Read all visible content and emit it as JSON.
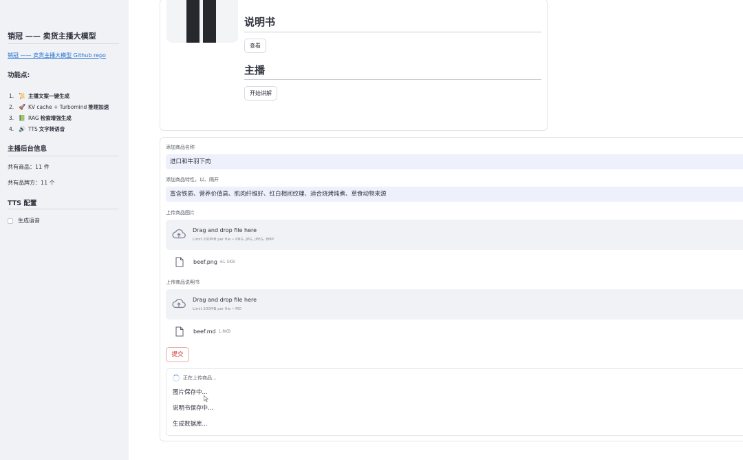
{
  "sidebar": {
    "title": "销冠 —— 卖货主播大模型",
    "repo_link": "销冠 —— 卖货主播大模型 Github repo",
    "features_heading": "功能点:",
    "features": [
      {
        "num": "1.",
        "icon": "scroll-icon",
        "glyph": "📜",
        "plain": "",
        "bold": "主播文案一键生成"
      },
      {
        "num": "2.",
        "icon": "rocket-icon",
        "glyph": "🚀",
        "plain": "KV cache + Turbomind",
        "bold": "推理加速"
      },
      {
        "num": "3.",
        "icon": "book-icon",
        "glyph": "📗",
        "plain": "RAG",
        "bold": "检索增强生成"
      },
      {
        "num": "4.",
        "icon": "speaker-icon",
        "glyph": "🔊",
        "plain": "TTS",
        "bold": "文字转语音"
      }
    ],
    "backend_heading": "主播后台信息",
    "product_count": "共有商品：11 件",
    "brand_count": "共有品牌方：11 个",
    "tts_heading": "TTS 配置",
    "tts_checkbox": "生成语音"
  },
  "product_card": {
    "manual_title": "说明书",
    "view_button": "查看",
    "anchor_title": "主播",
    "start_button": "开始讲解"
  },
  "form": {
    "name_label": "添加商品名称",
    "name_value": "进口和牛羽下肉",
    "features_label": "添加商品特性，以、隔开",
    "features_value": "富含铁质、营养价值高、肌肉纤维好、红白相间纹理、适合烧烤炖煮、草食动物来源",
    "image_label": "上传商品图片",
    "image_drop_main": "Drag and drop file here",
    "image_drop_sub": "Limit 200MB per file • PNG, JPG, JPEG, BMP",
    "image_file_name": "beef.png",
    "image_file_size": "61.5KB",
    "manual_label": "上传商品说明书",
    "manual_drop_main": "Drag and drop file here",
    "manual_drop_sub": "Limit 200MB per file • MD",
    "manual_file_name": "beef.md",
    "manual_file_size": "1.8KB",
    "submit_button": "提交"
  },
  "status": {
    "header": "正在上传商品...",
    "lines": [
      "图片保存中...",
      "说明书保存中...",
      "生成数据库..."
    ]
  },
  "colors": {
    "sidebar_bg": "#f0f2f6",
    "link": "#1f6fd1",
    "submit_red": "#d33a3a",
    "input_bg": "#eef1fb"
  }
}
